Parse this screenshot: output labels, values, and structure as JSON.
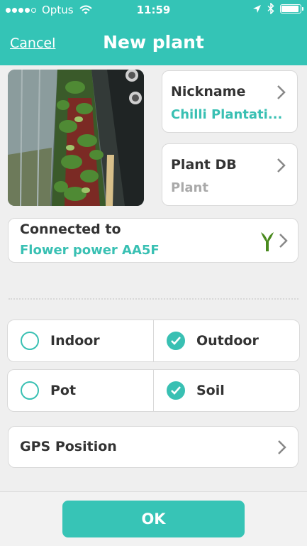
{
  "status_bar": {
    "carrier": "Optus",
    "time": "11:59"
  },
  "nav": {
    "cancel_label": "Cancel",
    "title": "New plant"
  },
  "nickname": {
    "label": "Nickname",
    "value": "Chilli Plantati..."
  },
  "plant_db": {
    "label": "Plant DB",
    "value": "Plant"
  },
  "connected": {
    "label": "Connected to",
    "value": "Flower power AA5F"
  },
  "environment": [
    {
      "label": "Indoor",
      "checked": false
    },
    {
      "label": "Outdoor",
      "checked": true
    }
  ],
  "medium": [
    {
      "label": "Pot",
      "checked": false
    },
    {
      "label": "Soil",
      "checked": true
    }
  ],
  "gps": {
    "label": "GPS Position"
  },
  "ok_label": "OK",
  "colors": {
    "accent": "#34c4b6",
    "sensor_green": "#4a8a1e",
    "background": "#efefef"
  }
}
